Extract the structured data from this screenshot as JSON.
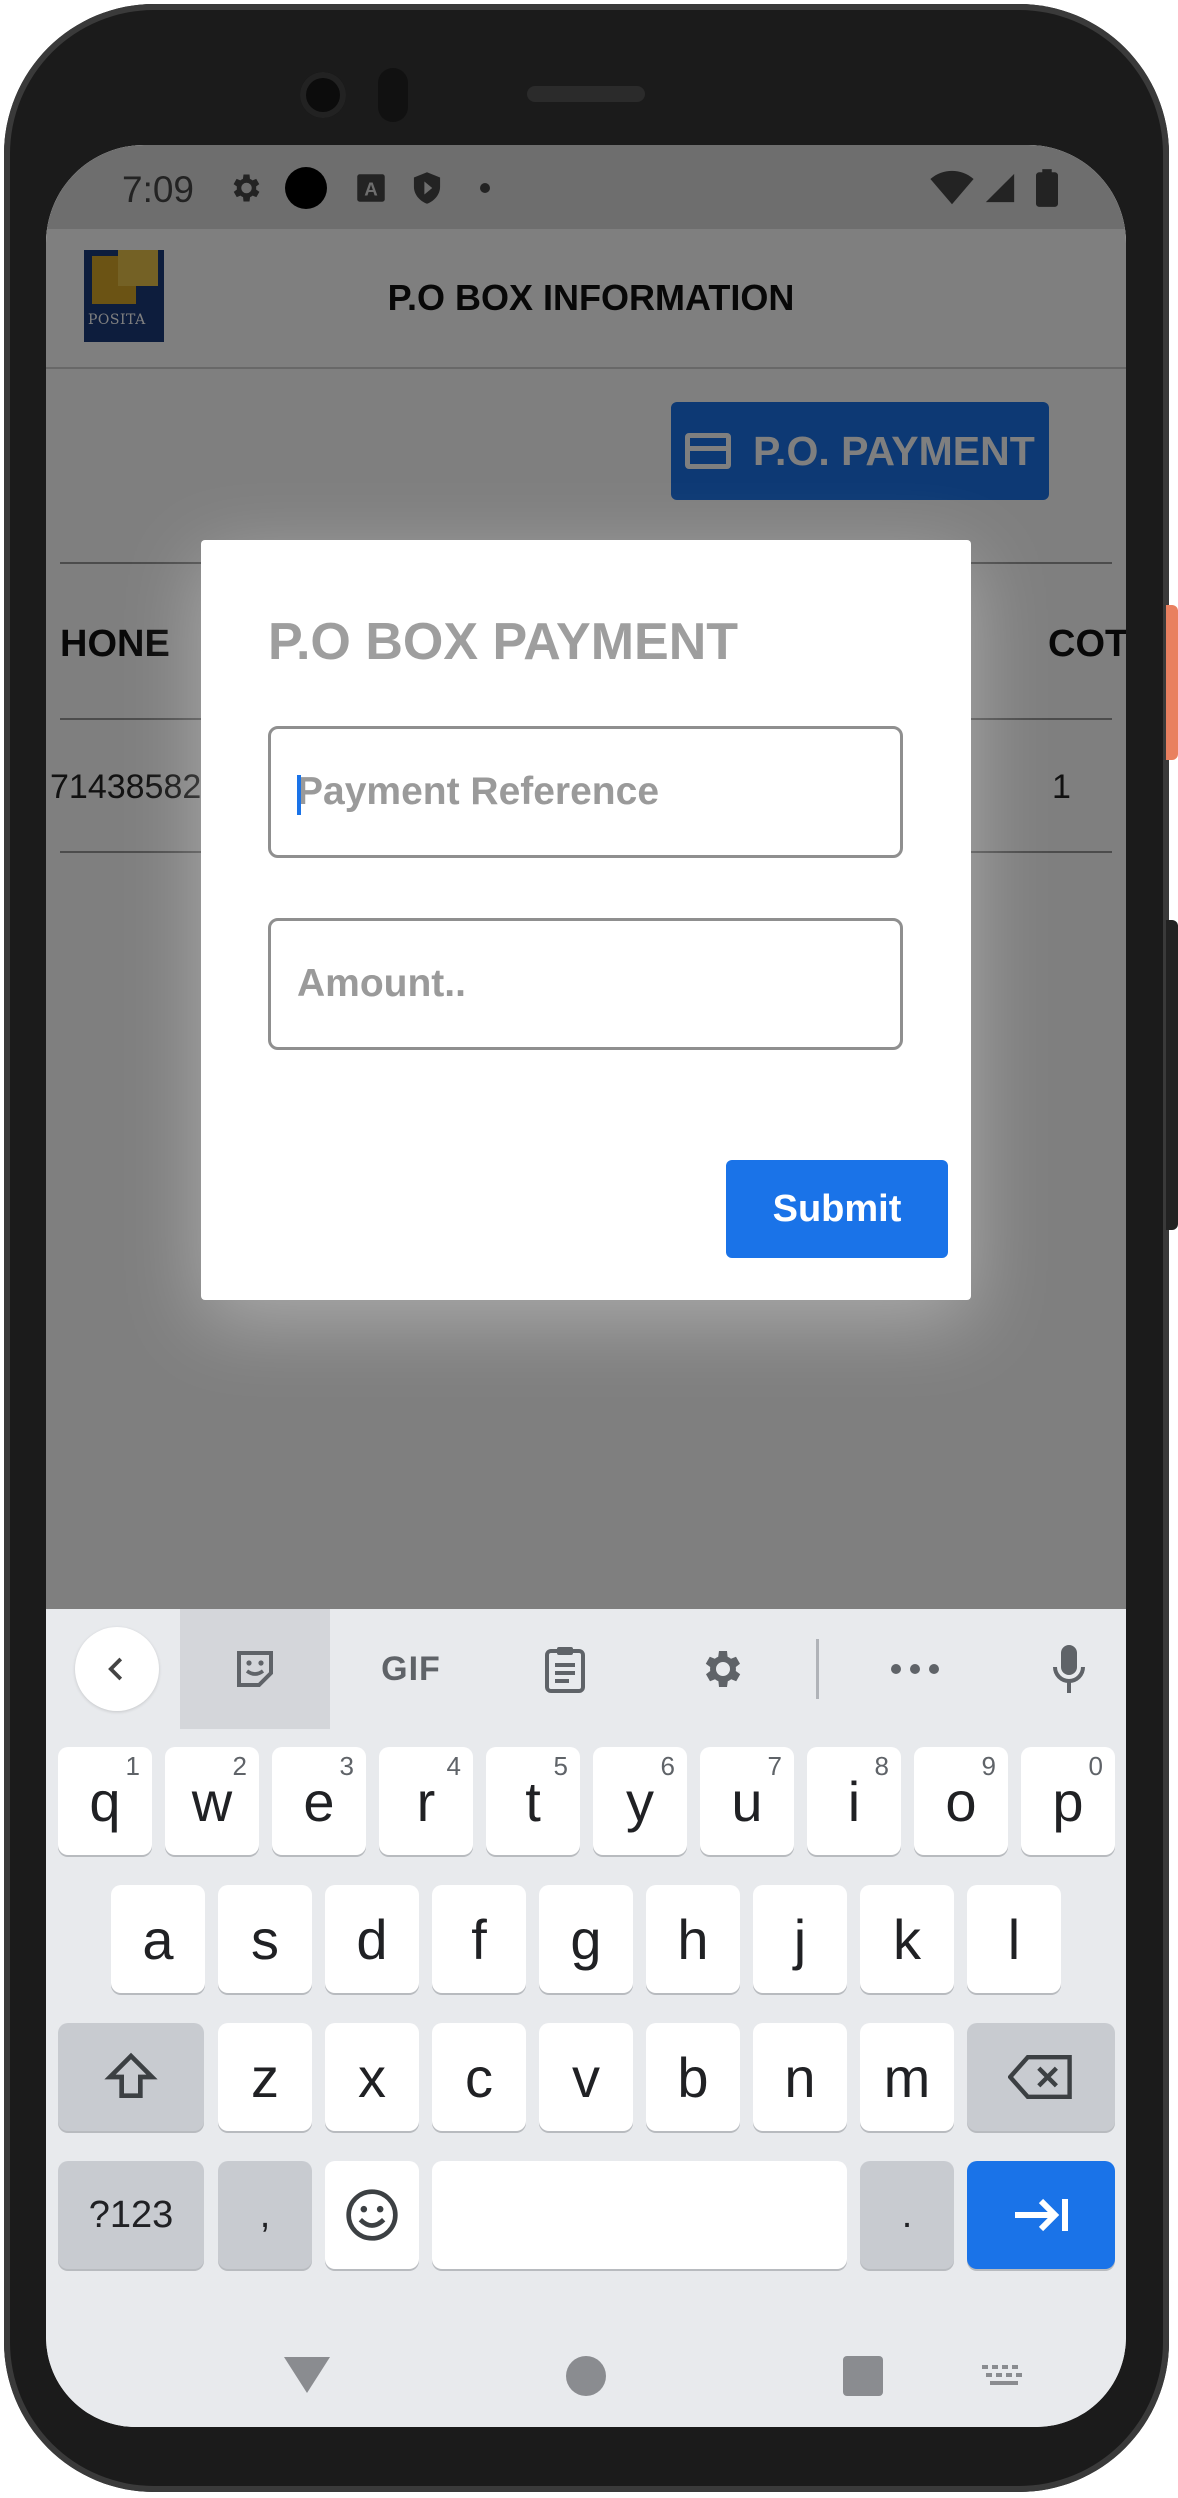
{
  "status_bar": {
    "time": "7:09",
    "left_icons": [
      "gear-icon",
      "record-icon",
      "font-a-icon",
      "shield-icon",
      "dot-icon"
    ],
    "right_icons": [
      "wifi-icon",
      "signal-icon",
      "battery-icon"
    ]
  },
  "app": {
    "title": "P.O BOX INFORMATION",
    "logo_text": "POSITA",
    "payment_button_label": "P.O. PAYMENT",
    "table": {
      "headers": [
        "HONE",
        "COT"
      ],
      "row": [
        "71438582",
        "1"
      ]
    }
  },
  "modal": {
    "title": "P.O BOX PAYMENT",
    "reference_placeholder": "Payment Reference",
    "amount_placeholder": "Amount..",
    "submit_label": "Submit"
  },
  "keyboard": {
    "toolbar": {
      "gif_label": "GIF",
      "icons": [
        "chevron-left-icon",
        "sticker-icon",
        "clipboard-icon",
        "gear-icon",
        "more-icon",
        "mic-icon"
      ]
    },
    "row1": [
      {
        "k": "q",
        "h": "1"
      },
      {
        "k": "w",
        "h": "2"
      },
      {
        "k": "e",
        "h": "3"
      },
      {
        "k": "r",
        "h": "4"
      },
      {
        "k": "t",
        "h": "5"
      },
      {
        "k": "y",
        "h": "6"
      },
      {
        "k": "u",
        "h": "7"
      },
      {
        "k": "i",
        "h": "8"
      },
      {
        "k": "o",
        "h": "9"
      },
      {
        "k": "p",
        "h": "0"
      }
    ],
    "row2": [
      "a",
      "s",
      "d",
      "f",
      "g",
      "h",
      "j",
      "k",
      "l"
    ],
    "row3": [
      "z",
      "x",
      "c",
      "v",
      "b",
      "n",
      "m"
    ],
    "symbols_label": "?123",
    "comma_label": ",",
    "period_label": "."
  },
  "colors": {
    "accent": "#1a73e8",
    "overlay": "rgba(0,0,0,0.5)",
    "keyboard_bg": "#e8eaed"
  }
}
